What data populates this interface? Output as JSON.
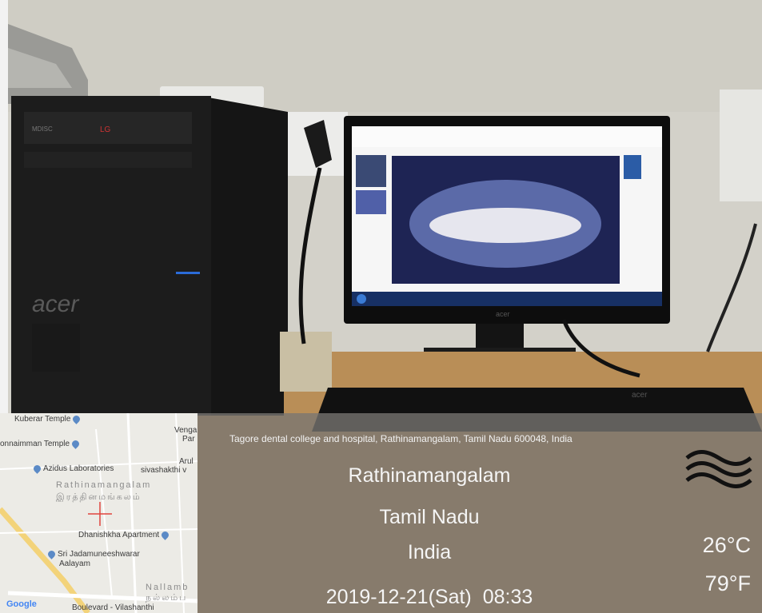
{
  "address": "Tagore dental college and hospital, Rathinamangalam, Tamil Nadu 600048, India",
  "location": {
    "city": "Rathinamangalam",
    "state": "Tamil Nadu",
    "country": "India"
  },
  "datetime": {
    "date": "2019-12-21(Sat)",
    "time": "08:33"
  },
  "weather": {
    "icon": "fog-wave-icon",
    "temp_c": "26°C",
    "temp_f": "79°F"
  },
  "map": {
    "labels": {
      "kuberar": "Kuberar Temple",
      "ponnaimman": "onnaimman Temple",
      "azidus": "Azidus Laboratories",
      "rathinamangalam": "Rathinamangalam",
      "rathinamangalam_ta": "இரத்தினமங்கலம்",
      "dhanishkha": "Dhanishkha Apartment",
      "jadamuneeshwarar": "Sri Jadamuneeshwarar",
      "aalayam": "Aalayam",
      "vengai": "Venga",
      "par": "Par",
      "arul": "Arul",
      "sivashakthi": "sivashakthi v",
      "nallamb": "Nallamb",
      "nallamb_ta": "நல்லம்ப",
      "boulevard": "Boulevard - Vilashanthi"
    },
    "logo": "Google"
  },
  "photo_description": {
    "monitor_brand": "acer",
    "tower_brand": "acer",
    "drive_brand": "LG"
  }
}
